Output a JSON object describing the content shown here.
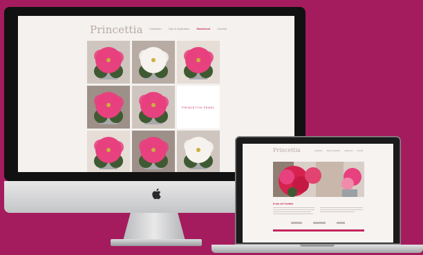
{
  "imac": {
    "site": {
      "logo": "Princettia",
      "nav": [
        {
          "label": "Collection",
          "active": false
        },
        {
          "label": "Tips & Inspiration",
          "active": false
        },
        {
          "label": "Gardenset",
          "active": true
        },
        {
          "label": "Contact",
          "active": false
        }
      ],
      "gallery": {
        "tiles": [
          {
            "kind": "photo",
            "icon": "poinsettia-pink-photo"
          },
          {
            "kind": "photo",
            "icon": "poinsettia-white-photo"
          },
          {
            "kind": "photo",
            "icon": "poinsettia-pink-photo"
          },
          {
            "kind": "photo",
            "icon": "poinsettia-pink-photo"
          },
          {
            "kind": "photo",
            "icon": "poinsettia-pink-photo"
          },
          {
            "kind": "text",
            "label": "Princettia pearl"
          },
          {
            "kind": "photo",
            "icon": "poinsettia-pink-photo"
          },
          {
            "kind": "photo",
            "icon": "poinsettia-pink-photo"
          },
          {
            "kind": "photo",
            "icon": "poinsettia-white-photo"
          }
        ]
      }
    }
  },
  "laptop": {
    "site": {
      "logo": "Princettia",
      "nav": [
        {
          "label": "Collection"
        },
        {
          "label": "Tips & Inspiration"
        },
        {
          "label": "Gardenset"
        },
        {
          "label": "Contact"
        }
      ],
      "section_title": "It can set Contact"
    }
  },
  "colors": {
    "background": "#a51c5e",
    "accent": "#c4245f",
    "poinsettia_pink": "#e8417f",
    "poinsettia_white": "#f6f2ee",
    "leaf": "#3f5a32"
  }
}
